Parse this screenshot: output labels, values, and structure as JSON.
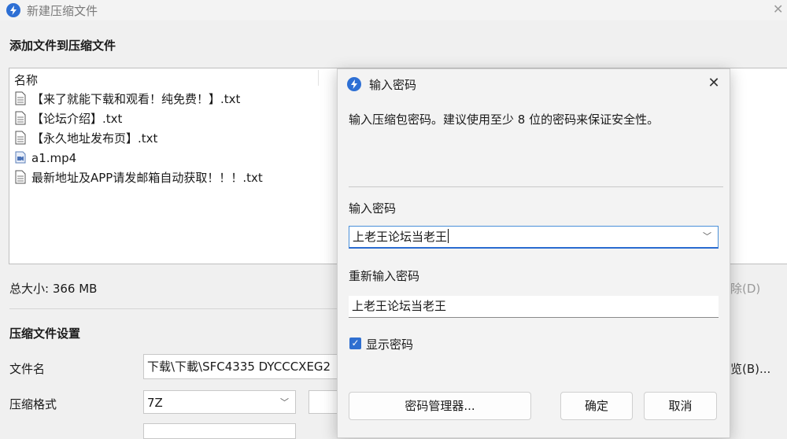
{
  "window": {
    "title": "新建压缩文件",
    "close_glyph": "✕"
  },
  "files_section": {
    "heading": "添加文件到压缩文件",
    "column_name": "名称",
    "files": [
      {
        "name": "【来了就能下载和观看！纯免费！】.txt",
        "icon": "text-file-icon"
      },
      {
        "name": "【论坛介绍】.txt",
        "icon": "text-file-icon"
      },
      {
        "name": "【永久地址发布页】.txt",
        "icon": "text-file-icon"
      },
      {
        "name": "a1.mp4",
        "icon": "video-file-icon"
      },
      {
        "name": "最新地址及APP请发邮箱自动获取！！！.txt",
        "icon": "text-file-icon"
      }
    ],
    "total_size": "总大小: 366 MB",
    "delete_button_partial": "除(D)"
  },
  "archive_settings": {
    "heading": "压缩文件设置",
    "filename_label": "文件名",
    "filename_value": "下载\\下載\\SFC4335 DYCCCXEG2",
    "browse_button_partial": "览(B)...",
    "format_label": "压缩格式",
    "format_value": "7Z"
  },
  "dialog": {
    "title": "输入密码",
    "close_glyph": "✕",
    "hint": "输入压缩包密码。建议使用至少 8 位的密码来保证安全性。",
    "password_label": "输入密码",
    "password_value": "上老王论坛当老王",
    "confirm_label": "重新输入密码",
    "confirm_value": "上老王论坛当老王",
    "show_password_label": "显示密码",
    "show_password_checked": true,
    "buttons": {
      "manager": "密码管理器...",
      "ok": "确定",
      "cancel": "取消"
    }
  },
  "colors": {
    "accent": "#2f6fd0",
    "background": "#f0f0f0"
  }
}
